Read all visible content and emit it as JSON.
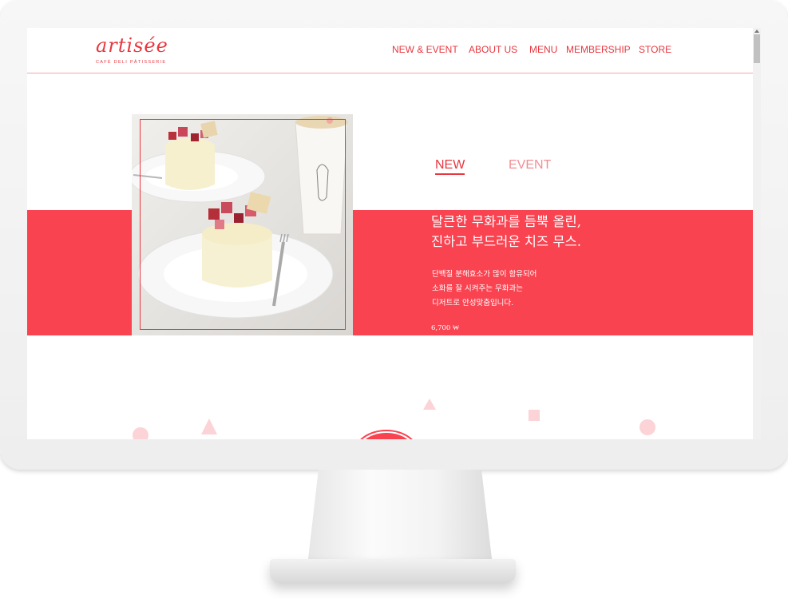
{
  "logo": {
    "wordmark": "artisée",
    "tagline": "CAFÉ DELI PÂTISSERIE"
  },
  "nav": [
    "NEW & EVENT",
    "ABOUT US",
    "MENU",
    "MEMBERSHIP",
    "STORE"
  ],
  "tabs": {
    "new": "NEW",
    "event": "EVENT"
  },
  "product": {
    "headline_line1": "달큰한 무화과를 듬뿍 올린,",
    "headline_line2": "진하고 부드러운 치즈 무스.",
    "desc_line1": "단백질 분해효소가 많이 함유되어",
    "desc_line2": "소화를 잘 시켜주는 무화과는",
    "desc_line3": "디저트로 안성맞춤입니다.",
    "price": "6,700 ₩"
  },
  "icons": [
    "cheesecake-photo",
    "scroll-up-arrow"
  ],
  "colors": {
    "brand_red": "#fa4350",
    "text_red": "#e8373f",
    "tab_inactive": "#f28d92",
    "header_rule": "#f7a3a6",
    "deco_pink": "#fcd3d6"
  }
}
